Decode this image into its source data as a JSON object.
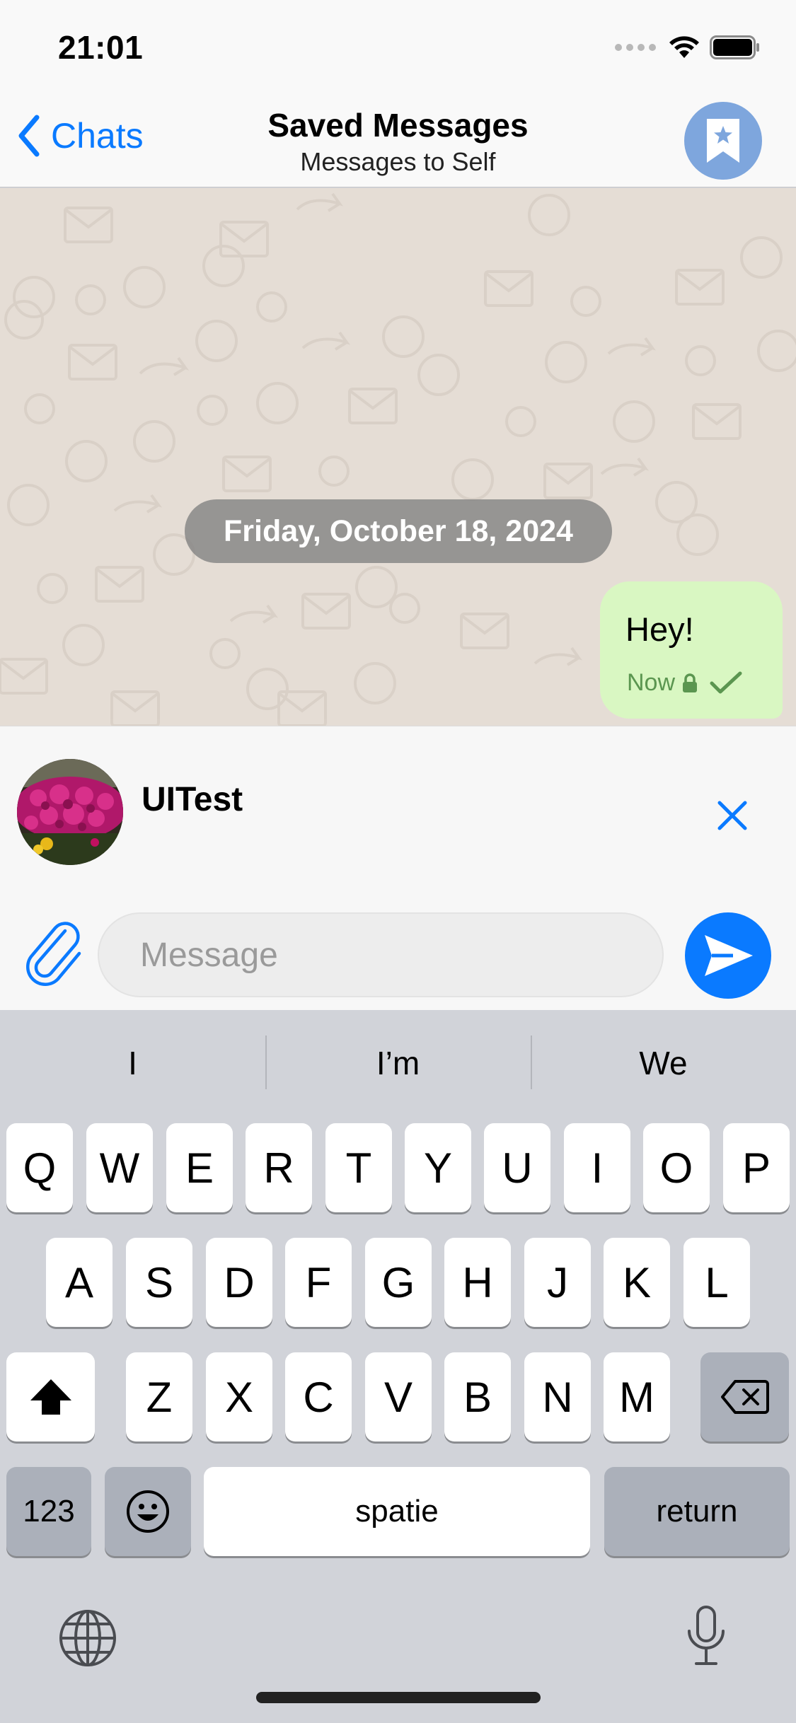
{
  "status_bar": {
    "time": "21:01"
  },
  "nav": {
    "back_label": "Chats",
    "title": "Saved Messages",
    "subtitle": "Messages to Self"
  },
  "chat": {
    "date_label": "Friday, October 18, 2024",
    "messages": [
      {
        "text": "Hey!",
        "time": "Now",
        "status": "sent"
      }
    ]
  },
  "reply_preview": {
    "name": "UITest"
  },
  "composer": {
    "placeholder": "Message"
  },
  "keyboard": {
    "suggestions": [
      "I",
      "I’m",
      "We"
    ],
    "row1": [
      "Q",
      "W",
      "E",
      "R",
      "T",
      "Y",
      "U",
      "I",
      "O",
      "P"
    ],
    "row2": [
      "A",
      "S",
      "D",
      "F",
      "G",
      "H",
      "J",
      "K",
      "L"
    ],
    "row3": [
      "Z",
      "X",
      "C",
      "V",
      "B",
      "N",
      "M"
    ],
    "numbers_label": "123",
    "space_label": "spatie",
    "return_label": "return"
  },
  "colors": {
    "accent": "#0a7aff",
    "outgoing_bubble": "#d9f7c2",
    "chat_background": "#e5ddd5",
    "saved_avatar": "#7ea6dd"
  }
}
